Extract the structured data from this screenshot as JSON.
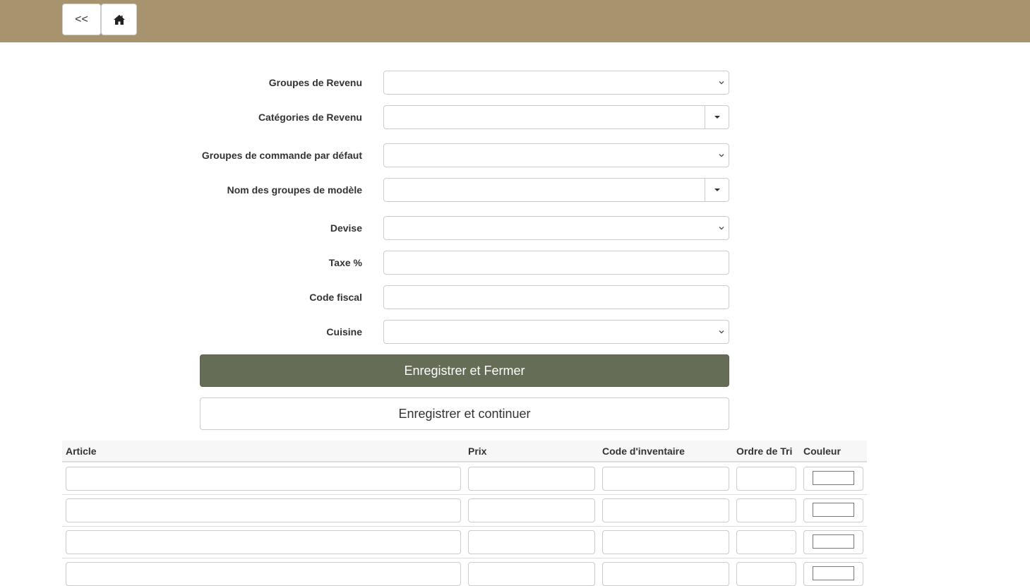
{
  "toolbar": {
    "back_label": "<<",
    "home_icon": "home-icon"
  },
  "form": {
    "fields": [
      {
        "label": "Groupes de Revenu",
        "type": "select",
        "value": ""
      },
      {
        "label": "Catégories de Revenu",
        "type": "dropdown",
        "value": ""
      },
      {
        "label": "Groupes de commande par défaut",
        "type": "select",
        "value": ""
      },
      {
        "label": "Nom des groupes de modèle",
        "type": "dropdown",
        "value": ""
      },
      {
        "label": "Devise",
        "type": "select",
        "value": ""
      },
      {
        "label": "Taxe %",
        "type": "text",
        "value": ""
      },
      {
        "label": "Code fiscal",
        "type": "text",
        "value": ""
      },
      {
        "label": "Cuisine",
        "type": "select",
        "value": ""
      }
    ],
    "save_close_label": "Enregistrer et Fermer",
    "save_continue_label": "Enregistrer et continuer"
  },
  "table": {
    "headers": [
      "Article",
      "Prix",
      "Code d'inventaire",
      "Ordre de Tri",
      "Couleur"
    ],
    "rows": [
      {
        "article": "",
        "prix": "",
        "code": "",
        "ordre": "",
        "couleur": "#ffffff"
      },
      {
        "article": "",
        "prix": "",
        "code": "",
        "ordre": "",
        "couleur": "#ffffff"
      },
      {
        "article": "",
        "prix": "",
        "code": "",
        "ordre": "",
        "couleur": "#ffffff"
      },
      {
        "article": "",
        "prix": "",
        "code": "",
        "ordre": "",
        "couleur": "#ffffff"
      }
    ]
  },
  "colors": {
    "header_bar": "#a8936f",
    "primary_button": "#656d57"
  }
}
